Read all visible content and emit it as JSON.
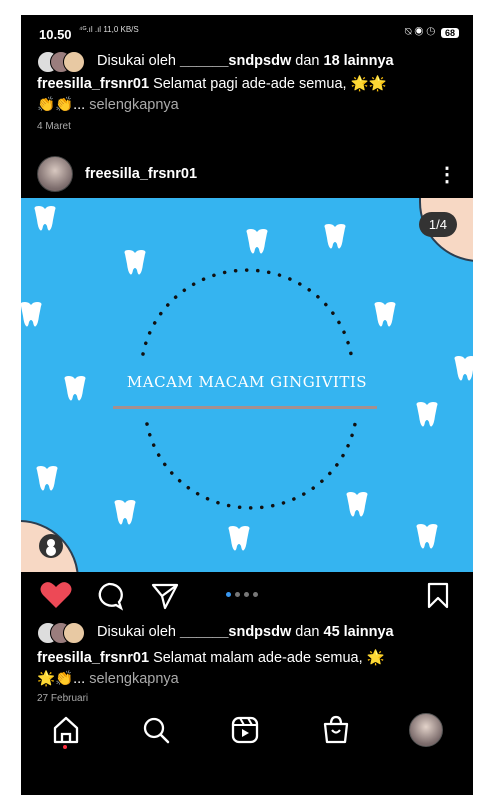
{
  "status": {
    "time": "10.50",
    "signal": "⁴ᴳ.ıl .ıl",
    "speed": "11,0 KB/S",
    "icons": "⍉ ◉ ◷",
    "battery": "68"
  },
  "top": {
    "likes_prefix": "Disukai oleh ",
    "likes_user": "______sndpsdw",
    "likes_mid": " dan ",
    "likes_count": "18 lainnya",
    "caption_user": "freesilla_frsnr01",
    "caption_text": " Selamat pagi ade-ade semua, 🌟🌟",
    "caption_line2": "👏👏... ",
    "more": "selengkapnya",
    "date": "4 Maret"
  },
  "post": {
    "username": "freesilla_frsnr01",
    "menu_icon": "⋮",
    "counter": "1/4",
    "image_title": "MACAM MACAM GINGIVITIS",
    "likes_prefix": "Disukai oleh ",
    "likes_user": "______sndpsdw",
    "likes_mid": " dan ",
    "likes_count": "45 lainnya",
    "caption_user": "freesilla_frsnr01",
    "caption_text": " Selamat malam ade-ade semua, 🌟",
    "caption_line2": "🌟👏... ",
    "more": "selengkapnya",
    "date": "27 Februari"
  },
  "colors": {
    "like": "#ed4956",
    "image_bg": "#35b4f0",
    "active_dot": "#3897f0"
  }
}
